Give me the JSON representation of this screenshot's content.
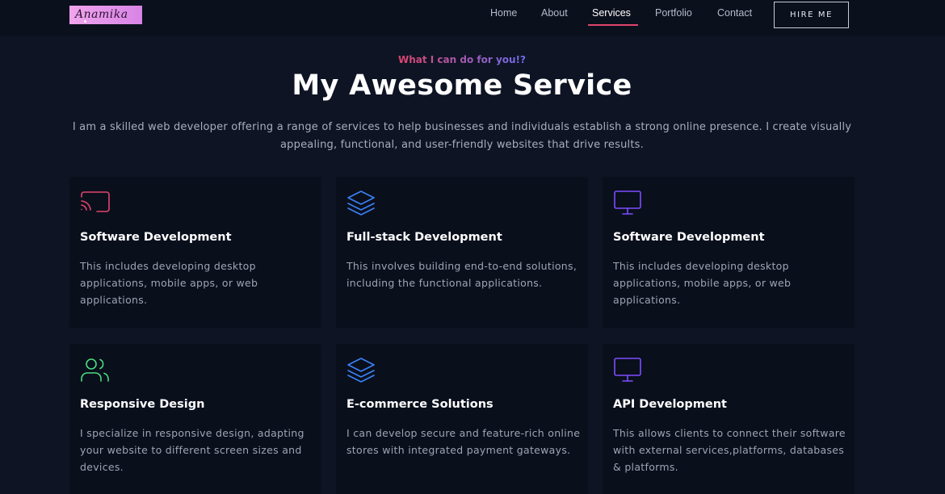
{
  "nav": {
    "logo_text": "Anamika",
    "links": [
      "Home",
      "About",
      "Services",
      "Portfolio",
      "Contact"
    ],
    "active_link": "Services",
    "hire_button": "HIRE ME"
  },
  "hero": {
    "eyebrow": "What I can do for you!?",
    "title": "My Awesome Service",
    "intro": "I am a skilled web developer offering a range of services to help businesses and individuals establish a strong online presence. I create visually appealing, functional, and user-friendly websites that drive results."
  },
  "services": [
    {
      "icon": "cast-icon",
      "icon_color": "#e0456c",
      "title": "Software Development",
      "description": "This includes developing desktop applications, mobile apps, or web applications."
    },
    {
      "icon": "layers-icon",
      "icon_color": "#3b82f6",
      "title": "Full-stack Development",
      "description": "This involves building end-to-end solutions, including the functional applications."
    },
    {
      "icon": "monitor-icon",
      "icon_color": "#7c4dff",
      "title": "Software Development",
      "description": "This includes developing desktop applications, mobile apps, or web applications."
    },
    {
      "icon": "users-icon",
      "icon_color": "#4ade80",
      "title": "Responsive Design",
      "description": "I specialize in responsive design, adapting your website to different screen sizes and devices."
    },
    {
      "icon": "layers-icon",
      "icon_color": "#3b82f6",
      "title": "E-commerce Solutions",
      "description": "I can develop secure and feature-rich online stores with integrated payment gateways."
    },
    {
      "icon": "monitor-icon",
      "icon_color": "#7c4dff",
      "title": "API Development",
      "description": "This allows clients to connect their software with external services,platforms, databases & platforms."
    }
  ],
  "colors": {
    "background": "#0e1424",
    "card_background": "#0a0f1c",
    "accent_pink": "#e0456c",
    "accent_blue": "#3b82f6",
    "accent_purple": "#7c4dff",
    "accent_green": "#4ade80"
  }
}
